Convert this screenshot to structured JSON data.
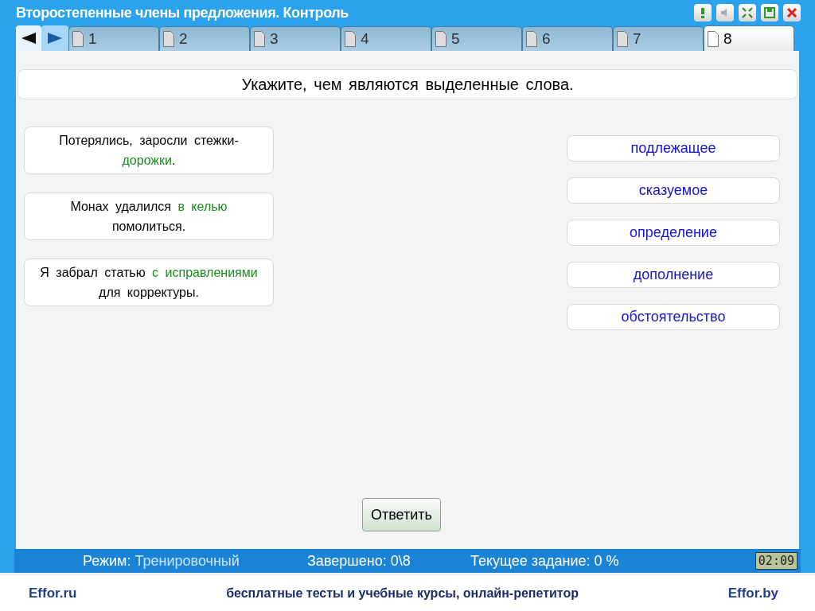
{
  "window": {
    "title": "Второстепенные члены предложения. Контроль"
  },
  "tabs": [
    {
      "label": "1",
      "selected": false
    },
    {
      "label": "2",
      "selected": false
    },
    {
      "label": "3",
      "selected": false
    },
    {
      "label": "4",
      "selected": false
    },
    {
      "label": "5",
      "selected": false
    },
    {
      "label": "6",
      "selected": false
    },
    {
      "label": "7",
      "selected": false
    },
    {
      "label": "8",
      "selected": true
    }
  ],
  "question": "Укажите, чем являются выделенные слова.",
  "sentences": [
    [
      {
        "text": "Потерялись, заросли стежки-",
        "highlighted": false
      },
      {
        "text": "дорожки",
        "highlighted": true
      },
      {
        "text": ".",
        "highlighted": false
      }
    ],
    [
      {
        "text": "Монах удалился ",
        "highlighted": false
      },
      {
        "text": "в келью",
        "highlighted": true
      },
      {
        "text": " помолиться.",
        "highlighted": false
      }
    ],
    [
      {
        "text": "Я забрал статью ",
        "highlighted": false
      },
      {
        "text": "с исправлениями",
        "highlighted": true
      },
      {
        "text": " для корректуры.",
        "highlighted": false
      }
    ]
  ],
  "options": [
    "подлежащее",
    "сказуемое",
    "определение",
    "дополнение",
    "обстоятельство"
  ],
  "answer_button": "Ответить",
  "status_bar": {
    "mode_label": "Режим:",
    "mode": "Тренировочный",
    "completed": "Завершено: 0\\8",
    "current": "Текущее задание: 0 %",
    "timer": "02:09"
  },
  "footer": {
    "left": "Effor.ru",
    "center": "бесплатные тесты и учебные курсы, онлайн-репетитор",
    "right": "Effor.by"
  }
}
